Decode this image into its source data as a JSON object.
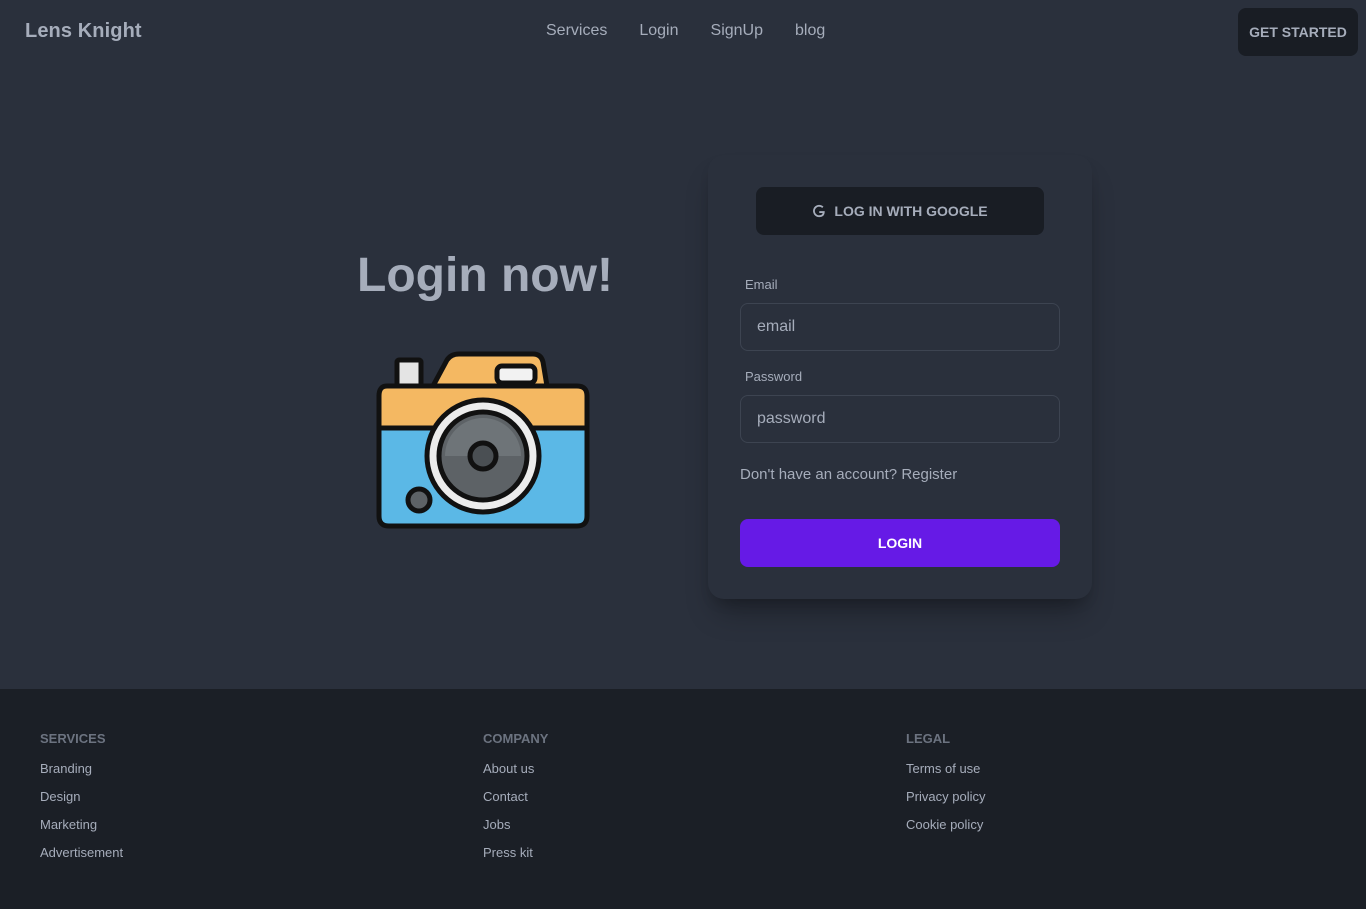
{
  "navbar": {
    "brand": "Lens Knight",
    "links": [
      "Services",
      "Login",
      "SignUp",
      "blog"
    ],
    "cta_label": "GET STARTED"
  },
  "hero": {
    "title": "Login now!",
    "illustration_icon": "camera-icon"
  },
  "login_card": {
    "google_button_label": "LOG IN WITH GOOGLE",
    "google_icon": "google-g-icon",
    "email_label": "Email",
    "email_placeholder": "email",
    "password_label": "Password",
    "password_placeholder": "password",
    "register_prompt": "Don't have an account?",
    "register_link": "Register",
    "login_button_label": "LOGIN"
  },
  "footer": {
    "columns": [
      {
        "title": "SERVICES",
        "links": [
          "Branding",
          "Design",
          "Marketing",
          "Advertisement"
        ]
      },
      {
        "title": "COMPANY",
        "links": [
          "About us",
          "Contact",
          "Jobs",
          "Press kit"
        ]
      },
      {
        "title": "LEGAL",
        "links": [
          "Terms of use",
          "Privacy policy",
          "Cookie policy"
        ]
      }
    ]
  },
  "colors": {
    "background": "#2a303c",
    "dark_button": "#191d24",
    "primary": "#661ae6",
    "footer_background": "#1b1f26",
    "text": "#a6adbb"
  }
}
